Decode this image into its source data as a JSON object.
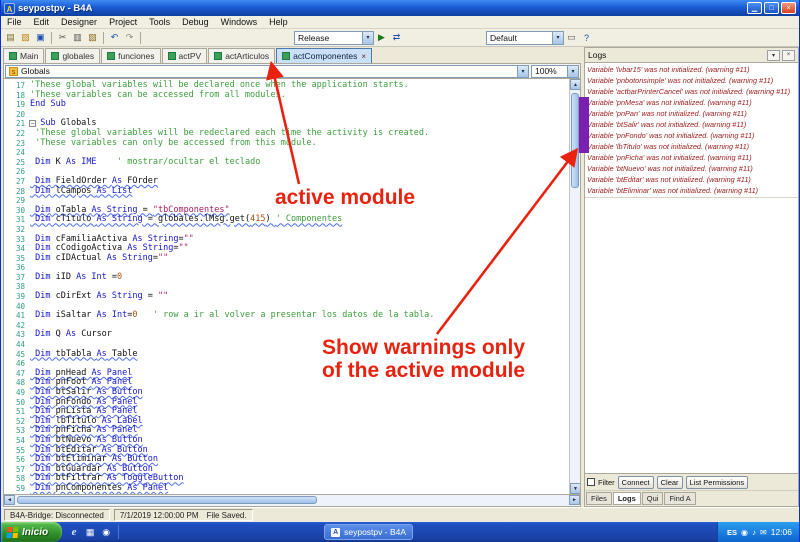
{
  "window": {
    "title": "seypostpv - B4A",
    "controls": {
      "minimize": "▁",
      "maximize": "□",
      "close": "×"
    }
  },
  "glyphs": {
    "dropdown": "▾",
    "up": "▲",
    "down": "▼",
    "left": "◄",
    "right": "►",
    "fold": "−",
    "close_tab": "×",
    "pin": "▾",
    "close_panel": "×"
  },
  "menu": {
    "items": [
      "File",
      "Edit",
      "Designer",
      "Project",
      "Tools",
      "Debug",
      "Windows",
      "Help"
    ]
  },
  "toolbar": {
    "items": [
      {
        "t": "icon",
        "name": "new-file",
        "g": "▤",
        "c": "#7a6a2a"
      },
      {
        "t": "icon",
        "name": "open-project",
        "g": "▨",
        "c": "#b8860b"
      },
      {
        "t": "icon",
        "name": "save",
        "g": "▣",
        "c": "#1a50b0"
      },
      {
        "t": "sep"
      },
      {
        "t": "icon",
        "name": "cut",
        "g": "✂",
        "c": "#555555"
      },
      {
        "t": "icon",
        "name": "copy",
        "g": "▥",
        "c": "#555555"
      },
      {
        "t": "icon",
        "name": "paste",
        "g": "▧",
        "c": "#8a6a1a"
      },
      {
        "t": "sep"
      },
      {
        "t": "icon",
        "name": "undo",
        "g": "↶",
        "c": "#1a50b0"
      },
      {
        "t": "icon",
        "name": "redo",
        "g": "↷",
        "c": "#888888"
      },
      {
        "t": "sep"
      },
      {
        "t": "select",
        "name": "release-mode",
        "value": "Release"
      },
      {
        "t": "icon",
        "name": "compile-run",
        "g": "▶",
        "c": "#1a7a1a"
      },
      {
        "t": "icon",
        "name": "bridge",
        "g": "⇄",
        "c": "#1a50b0"
      },
      {
        "t": "select",
        "name": "build-config",
        "value": "Default"
      },
      {
        "t": "icon",
        "name": "designer",
        "g": "▭",
        "c": "#555555"
      },
      {
        "t": "icon",
        "name": "help",
        "g": "?",
        "c": "#1a50b0"
      }
    ]
  },
  "tabs": [
    {
      "label": "Main",
      "active": false
    },
    {
      "label": "globales",
      "active": false
    },
    {
      "label": "funciones",
      "active": false
    },
    {
      "label": "actPV",
      "active": false
    },
    {
      "label": "actArticulos",
      "active": false
    },
    {
      "label": "actComponentes",
      "active": true
    }
  ],
  "editor": {
    "member_selector": "Globals",
    "zoom": "100%",
    "fold_line": 21,
    "lines": [
      [
        17,
        0,
        [
          [
            "c",
            "'These global variables will be declared once when the application starts."
          ]
        ]
      ],
      [
        18,
        0,
        [
          [
            "c",
            "'These variables can be accessed from all modules."
          ]
        ]
      ],
      [
        19,
        0,
        [
          [
            "k",
            "End Sub"
          ]
        ]
      ],
      [
        20,
        0,
        []
      ],
      [
        21,
        0,
        [
          [
            "k",
            "  Sub"
          ],
          [
            "i",
            " Globals"
          ]
        ]
      ],
      [
        22,
        0,
        [
          [
            "c",
            " 'These global variables will be redeclared each time the activity is created."
          ]
        ]
      ],
      [
        23,
        0,
        [
          [
            "c",
            " 'These variables can only be accessed from this module."
          ]
        ]
      ],
      [
        24,
        0,
        []
      ],
      [
        25,
        0,
        [
          [
            "k",
            " Dim"
          ],
          [
            "i",
            " K "
          ],
          [
            "k",
            "As IME"
          ],
          [
            "c",
            "    ' mostrar/ocultar el teclado"
          ]
        ]
      ],
      [
        26,
        0,
        []
      ],
      [
        27,
        1,
        [
          [
            "k",
            " Dim"
          ],
          [
            "i",
            " FieldOrder "
          ],
          [
            "k",
            "As"
          ],
          [
            "i",
            " FOrder"
          ]
        ]
      ],
      [
        28,
        1,
        [
          [
            "k",
            " Dim"
          ],
          [
            "i",
            " lCampos "
          ],
          [
            "k",
            "As List"
          ]
        ]
      ],
      [
        29,
        0,
        []
      ],
      [
        30,
        1,
        [
          [
            "k",
            " Dim"
          ],
          [
            "i",
            " oTabla "
          ],
          [
            "k",
            "As String"
          ],
          [
            "i",
            " = "
          ],
          [
            "s",
            "\"tbComponentes\""
          ]
        ]
      ],
      [
        31,
        1,
        [
          [
            "k",
            " Dim"
          ],
          [
            "i",
            " cTitulo "
          ],
          [
            "k",
            "As String"
          ],
          [
            "i",
            " = globales.lMsg.get("
          ],
          [
            "n",
            "415"
          ],
          [
            "i",
            ") "
          ],
          [
            "c",
            "' Componentes"
          ]
        ]
      ],
      [
        32,
        0,
        []
      ],
      [
        33,
        0,
        [
          [
            "k",
            " Dim"
          ],
          [
            "i",
            " cFamiliaActiva "
          ],
          [
            "k",
            "As String"
          ],
          [
            "i",
            "="
          ],
          [
            "s",
            "\"\""
          ]
        ]
      ],
      [
        34,
        0,
        [
          [
            "k",
            " Dim"
          ],
          [
            "i",
            " cCodigoActiva "
          ],
          [
            "k",
            "As String"
          ],
          [
            "i",
            "="
          ],
          [
            "s",
            "\"\""
          ]
        ]
      ],
      [
        35,
        0,
        [
          [
            "k",
            " Dim"
          ],
          [
            "i",
            " cIDActual "
          ],
          [
            "k",
            "As String"
          ],
          [
            "i",
            "="
          ],
          [
            "s",
            "\"\""
          ]
        ]
      ],
      [
        36,
        0,
        []
      ],
      [
        37,
        0,
        [
          [
            "k",
            " Dim"
          ],
          [
            "i",
            " iID "
          ],
          [
            "k",
            "As Int"
          ],
          [
            "i",
            " ="
          ],
          [
            "n",
            "0"
          ]
        ]
      ],
      [
        38,
        0,
        []
      ],
      [
        39,
        0,
        [
          [
            "k",
            " Dim"
          ],
          [
            "i",
            " cDirExt "
          ],
          [
            "k",
            "As String"
          ],
          [
            "i",
            " = "
          ],
          [
            "s",
            "\"\""
          ]
        ]
      ],
      [
        40,
        0,
        []
      ],
      [
        41,
        0,
        [
          [
            "k",
            " Dim"
          ],
          [
            "i",
            " iSaltar "
          ],
          [
            "k",
            "As Int"
          ],
          [
            "i",
            "="
          ],
          [
            "n",
            "0"
          ],
          [
            "c",
            "   ' row a ir al volver a presentar los datos de la tabla."
          ]
        ]
      ],
      [
        42,
        0,
        []
      ],
      [
        43,
        0,
        [
          [
            "k",
            " Dim"
          ],
          [
            "i",
            " Q "
          ],
          [
            "k",
            "As"
          ],
          [
            "i",
            " Cursor"
          ]
        ]
      ],
      [
        44,
        0,
        []
      ],
      [
        45,
        1,
        [
          [
            "k",
            " Dim"
          ],
          [
            "i",
            " tbTabla "
          ],
          [
            "k",
            "As"
          ],
          [
            "i",
            " Table"
          ]
        ]
      ],
      [
        46,
        0,
        []
      ],
      [
        47,
        1,
        [
          [
            "k",
            " Dim"
          ],
          [
            "i",
            " pnHead "
          ],
          [
            "k",
            "As Panel"
          ]
        ]
      ],
      [
        48,
        1,
        [
          [
            "k",
            " Dim"
          ],
          [
            "i",
            " pnFoot "
          ],
          [
            "k",
            "As Panel"
          ]
        ]
      ],
      [
        49,
        1,
        [
          [
            "k",
            " Dim"
          ],
          [
            "i",
            " btSalir "
          ],
          [
            "k",
            "As Button"
          ]
        ]
      ],
      [
        50,
        1,
        [
          [
            "k",
            " Dim"
          ],
          [
            "i",
            " pnFondo "
          ],
          [
            "k",
            "As Panel"
          ]
        ]
      ],
      [
        51,
        1,
        [
          [
            "k",
            " Dim"
          ],
          [
            "i",
            " pnLista "
          ],
          [
            "k",
            "As Panel"
          ]
        ]
      ],
      [
        52,
        1,
        [
          [
            "k",
            " Dim"
          ],
          [
            "i",
            " lbTitulo "
          ],
          [
            "k",
            "As Label"
          ]
        ]
      ],
      [
        53,
        1,
        [
          [
            "k",
            " Dim"
          ],
          [
            "i",
            " pnFicha "
          ],
          [
            "k",
            "As Panel"
          ]
        ]
      ],
      [
        54,
        1,
        [
          [
            "k",
            " Dim"
          ],
          [
            "i",
            " btNuevo "
          ],
          [
            "k",
            "As Button"
          ]
        ]
      ],
      [
        55,
        1,
        [
          [
            "k",
            " Dim"
          ],
          [
            "i",
            " btEditar "
          ],
          [
            "k",
            "As Button"
          ]
        ]
      ],
      [
        56,
        1,
        [
          [
            "k",
            " Dim"
          ],
          [
            "i",
            " btEliminar "
          ],
          [
            "k",
            "As Button"
          ]
        ]
      ],
      [
        57,
        1,
        [
          [
            "k",
            " Dim"
          ],
          [
            "i",
            " btGuardar "
          ],
          [
            "k",
            "As Button"
          ]
        ]
      ],
      [
        58,
        1,
        [
          [
            "k",
            " Dim"
          ],
          [
            "i",
            " btFiltrar "
          ],
          [
            "k",
            "As ToggleButton"
          ]
        ]
      ],
      [
        59,
        1,
        [
          [
            "k",
            " Dim"
          ],
          [
            "i",
            " pnComponentes "
          ],
          [
            "k",
            "As Panel"
          ]
        ]
      ]
    ]
  },
  "logs": {
    "title": "Logs",
    "warnings": [
      "Variable 'lvbar15' was not initialized. (warning #11)",
      "Variable 'pnbotonsimple' was not initialized. (warning #11)",
      "Variable 'actbarPrinterCancel' was not initialized. (warning #11)",
      "Variable 'pnMesa' was not initialized. (warning #11)",
      "Variable 'pnPan' was not initialized. (warning #11)",
      "Variable 'btSalir' was not initialized. (warning #11)",
      "Variable 'pnFondo' was not initialized. (warning #11)",
      "Variable 'lbTitulo' was not initialized. (warning #11)",
      "Variable 'pnFicha' was not initialized. (warning #11)",
      "Variable 'btNuevo' was not initialized. (warning #11)",
      "Variable 'btEditar' was not initialized. (warning #11)",
      "Variable 'btEliminar' was not initialized. (warning #11)"
    ],
    "controls": {
      "filter": "Filter",
      "connect": "Connect",
      "clear": "Clear",
      "list_permissions": "List Permissions"
    },
    "panel_tabs": [
      {
        "label": "Files",
        "active": false
      },
      {
        "label": "Logs",
        "active": true
      },
      {
        "label": "Qui",
        "active": false
      },
      {
        "label": "Find A",
        "active": false
      }
    ]
  },
  "status_bar": {
    "bridge": "B4A-Bridge: Disconnected",
    "datetime": "7/1/2019 12:00:00 PM",
    "saved": "File Saved."
  },
  "taskbar": {
    "start_label": "Inicio",
    "quick_launch": [
      {
        "name": "internet-explorer-icon",
        "g": "e"
      },
      {
        "name": "show-desktop-icon",
        "g": "▦"
      },
      {
        "name": "media-player-icon",
        "g": "◉"
      }
    ],
    "task_button": "seypostpv - B4A",
    "tray": [
      {
        "name": "language-indicator",
        "label": "ES"
      },
      {
        "name": "network-icon",
        "g": "◉"
      },
      {
        "name": "volume-icon",
        "g": "♪"
      },
      {
        "name": "messenger-icon",
        "g": "✉"
      }
    ],
    "clock": "12:06"
  },
  "annotations": {
    "active_module_label": "active module",
    "warnings_label_line1": "Show warnings only",
    "warnings_label_line2": "of the active module"
  }
}
